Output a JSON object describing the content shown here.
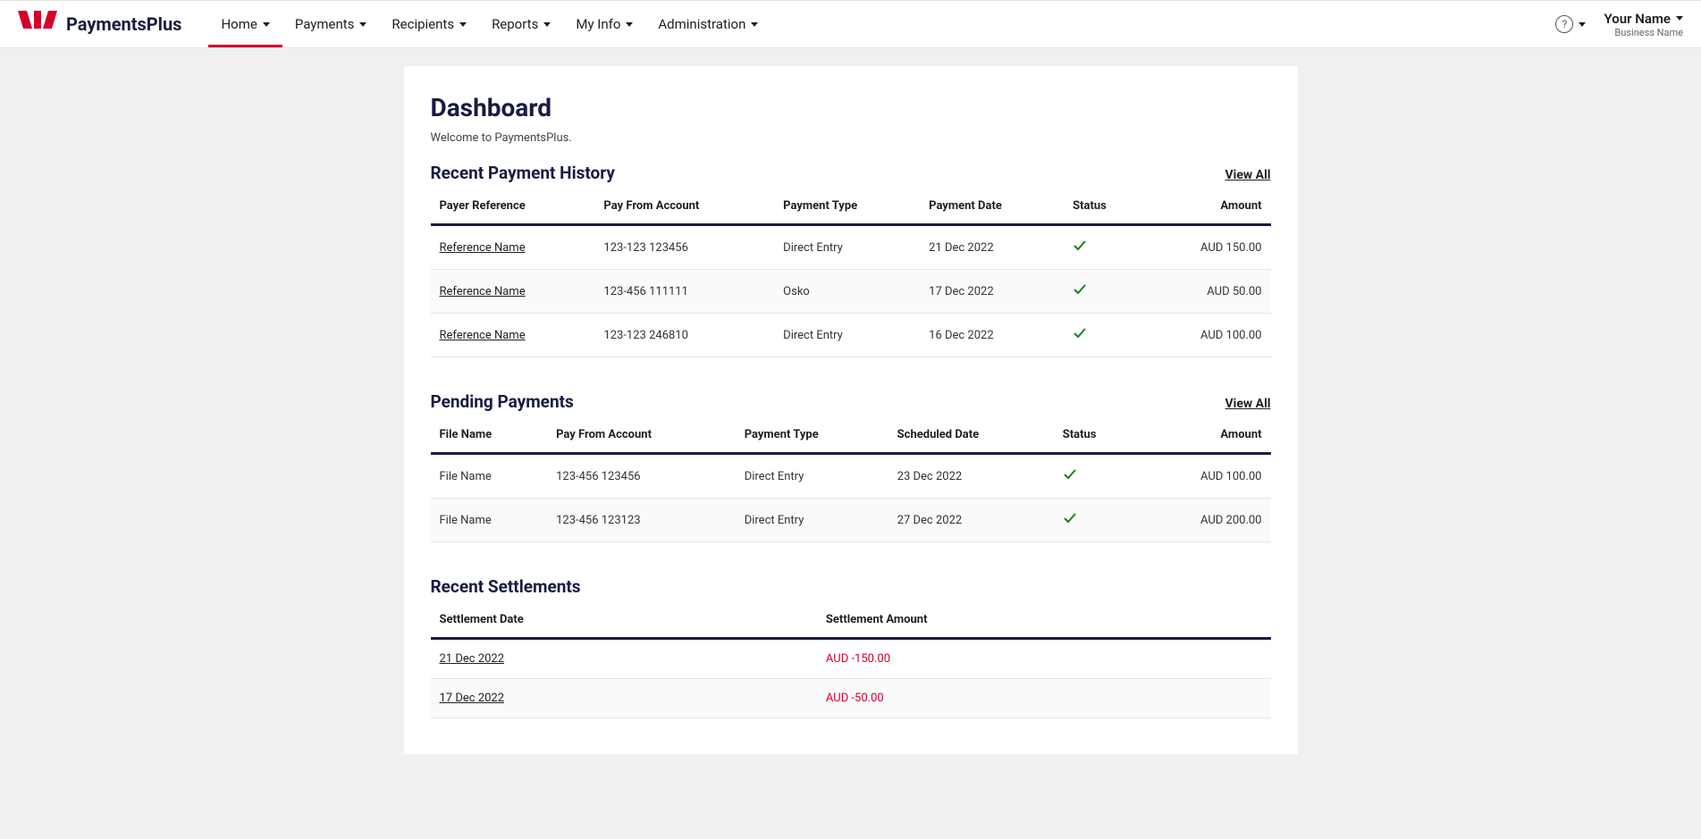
{
  "brand": "PaymentsPlus",
  "nav": {
    "home": "Home",
    "payments": "Payments",
    "recipients": "Recipients",
    "reports": "Reports",
    "myinfo": "My Info",
    "admin": "Administration"
  },
  "user": {
    "name": "Your Name",
    "business": "Business Name"
  },
  "page": {
    "title": "Dashboard",
    "welcome": "Welcome to PaymentsPlus."
  },
  "history": {
    "title": "Recent Payment History",
    "view_all": "View All",
    "headers": {
      "ref": "Payer Reference",
      "acct": "Pay From Account",
      "type": "Payment Type",
      "date": "Payment Date",
      "status": "Status",
      "amount": "Amount"
    },
    "rows": [
      {
        "ref": "Reference Name",
        "acct": "123-123 123456",
        "type": "Direct Entry",
        "date": "21 Dec 2022",
        "amount": "AUD 150.00"
      },
      {
        "ref": "Reference Name",
        "acct": "123-456 111111",
        "type": "Osko",
        "date": "17 Dec 2022",
        "amount": "AUD 50.00"
      },
      {
        "ref": "Reference Name",
        "acct": "123-123 246810",
        "type": "Direct Entry",
        "date": "16 Dec 2022",
        "amount": "AUD 100.00"
      }
    ]
  },
  "pending": {
    "title": "Pending Payments",
    "view_all": "View All",
    "headers": {
      "file": "File Name",
      "acct": "Pay From Account",
      "type": "Payment Type",
      "date": "Scheduled Date",
      "status": "Status",
      "amount": "Amount"
    },
    "rows": [
      {
        "file": "File Name",
        "acct": "123-456 123456",
        "type": "Direct Entry",
        "date": "23 Dec 2022",
        "amount": "AUD 100.00"
      },
      {
        "file": "File Name",
        "acct": "123-456 123123",
        "type": "Direct Entry",
        "date": "27 Dec 2022",
        "amount": "AUD 200.00"
      }
    ]
  },
  "settlements": {
    "title": "Recent Settlements",
    "headers": {
      "date": "Settlement Date",
      "amount": "Settlement Amount"
    },
    "rows": [
      {
        "date": "21 Dec 2022",
        "amount": "AUD -150.00"
      },
      {
        "date": "17 Dec 2022",
        "amount": "AUD -50.00"
      }
    ]
  }
}
